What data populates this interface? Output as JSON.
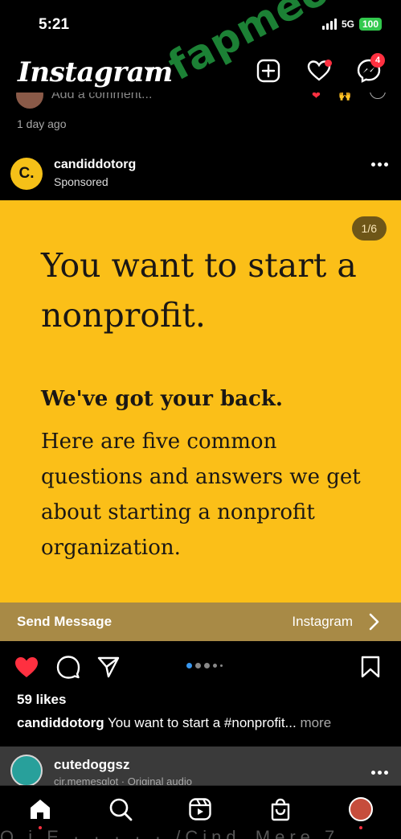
{
  "status": {
    "time": "5:21",
    "network": "5G",
    "battery": "100"
  },
  "header": {
    "logo": "Instagram",
    "messages_badge": "4"
  },
  "watermark": "fapmeow.com",
  "previous_post": {
    "comment_placeholder": "Add a comment...",
    "timestamp": "1 day ago"
  },
  "post": {
    "avatar_letter": "C.",
    "username": "candiddotorg",
    "label": "Sponsored",
    "slide_counter": "1/6",
    "headline": "You want to start a nonprofit.",
    "strong_line": "We've got your back.",
    "body": "Here are five common questions and answers we get about starting a nonprofit organization.",
    "cta_label": "Send Message",
    "cta_source": "Instagram",
    "likes": "59 likes",
    "caption_user": "candiddotorg",
    "caption_text": " You want to start a #nonprofit...",
    "caption_more": " more",
    "carousel": {
      "total": 5,
      "active": 0
    }
  },
  "next_post": {
    "username": "cutedoggsz",
    "subtitle": "cir.memesglot · Original audio"
  },
  "colors": {
    "ad_background": "#fbbf18",
    "cta_bar": "#a88a46",
    "like_red": "#ff3040",
    "carousel_active": "#3897f0",
    "watermark_green": "#1f8c3a"
  },
  "icons": {
    "header": [
      "create-post-icon",
      "heart-icon",
      "messenger-icon"
    ],
    "actions": [
      "liked-heart-icon",
      "comment-icon",
      "share-icon",
      "bookmark-icon"
    ],
    "tabs": [
      "home-icon",
      "search-icon",
      "reels-icon",
      "shop-icon",
      "profile-avatar"
    ]
  },
  "bottom_ghost_text": "Q i E · · · · · /Cind_Mere 7"
}
